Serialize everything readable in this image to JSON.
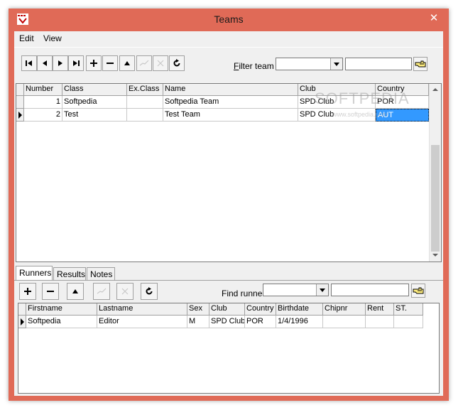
{
  "window": {
    "title": "Teams",
    "close_glyph": "✕",
    "icon": "app-icon",
    "accent": "#e06a57"
  },
  "menu": {
    "edit": "Edit",
    "view": "View"
  },
  "teams_toolbar": {
    "filter_label": "Filter team",
    "filter_underline": "F",
    "filter_rest": "ilter team",
    "filter_combo_value": "",
    "filter_text_value": ""
  },
  "teams_table": {
    "columns": [
      "Number",
      "Class",
      "Ex.Class",
      "Name",
      "Club",
      "Country"
    ],
    "rows": [
      {
        "number": "1",
        "class": "Softpedia",
        "exclass": "",
        "name": "Softpedia Team",
        "club": "SPD Club",
        "country": "POR"
      },
      {
        "number": "2",
        "class": "Test",
        "exclass": "",
        "name": "Test Team",
        "club": "SPD Club",
        "country": "AUT"
      }
    ],
    "selected_row": 1,
    "selected_color": "#3399ff"
  },
  "tabs": [
    "Runners",
    "Results",
    "Notes"
  ],
  "runners_toolbar": {
    "find_label": "Find runner",
    "find_combo_value": "",
    "find_text_value": ""
  },
  "runners_table": {
    "columns": [
      "Firstname",
      "Lastname",
      "Sex",
      "Club",
      "Country",
      "Birthdate",
      "Chipnr",
      "Rent",
      "ST."
    ],
    "rows": [
      {
        "firstname": "Softpedia",
        "lastname": "Editor",
        "sex": "M",
        "club": "SPD Club",
        "country": "POR",
        "birthdate": "1/4/1996",
        "chipnr": "",
        "rent": "",
        "st": ""
      }
    ]
  },
  "watermark": {
    "big": "SOFTPEDIA",
    "small": "www.softpedia.com"
  }
}
